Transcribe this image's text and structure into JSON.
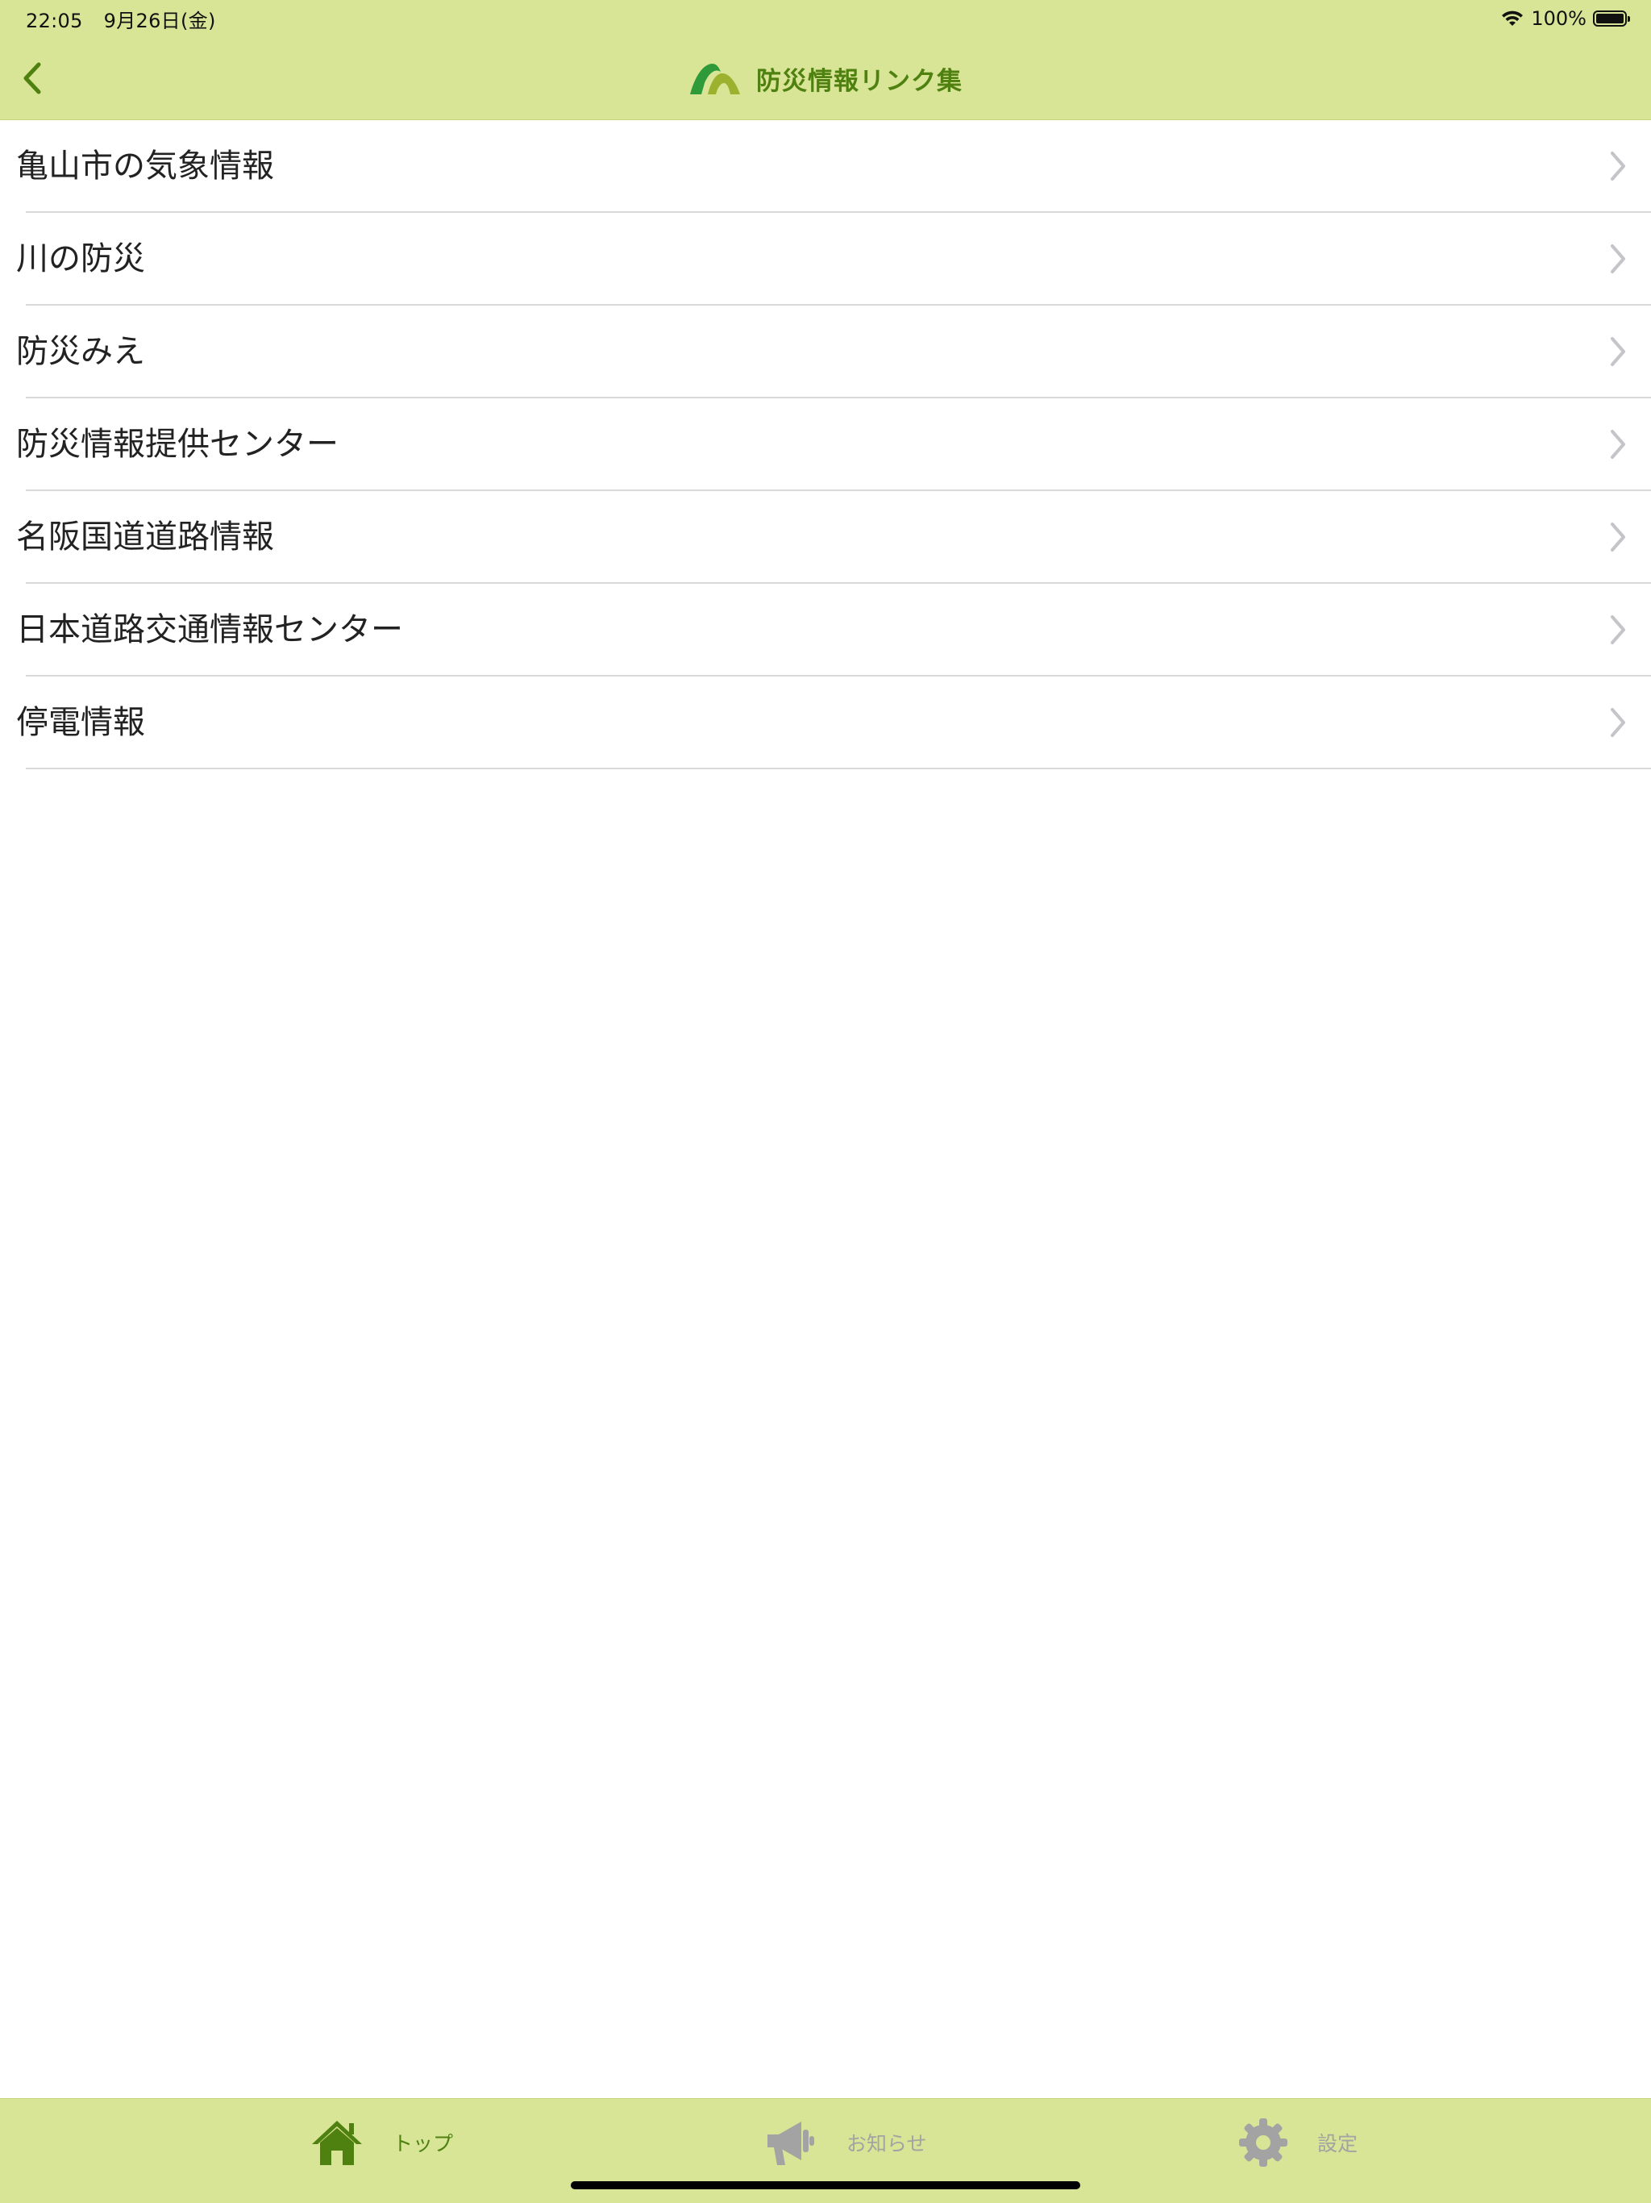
{
  "status_bar": {
    "time": "22:05",
    "date": "9月26日(金)",
    "battery_percent": "100%",
    "battery_level": 1.0
  },
  "nav": {
    "title": "防災情報リンク集",
    "back_icon": "chevron-left-icon",
    "logo_icon": "mountain-logo-icon"
  },
  "links": [
    {
      "label": "亀山市の気象情報"
    },
    {
      "label": "川の防災"
    },
    {
      "label": "防災みえ"
    },
    {
      "label": "防災情報提供センター"
    },
    {
      "label": "名阪国道道路情報"
    },
    {
      "label": "日本道路交通情報センター"
    },
    {
      "label": "停電情報"
    }
  ],
  "tabs": [
    {
      "label": "トップ",
      "icon": "home-icon",
      "active": true
    },
    {
      "label": "お知らせ",
      "icon": "megaphone-icon",
      "active": false
    },
    {
      "label": "設定",
      "icon": "gear-icon",
      "active": false
    }
  ],
  "colors": {
    "bar_background": "#d8e496",
    "accent_green": "#4f8110",
    "inactive_gray": "#a3a3a3",
    "chevron_gray": "#c4c4c9"
  }
}
